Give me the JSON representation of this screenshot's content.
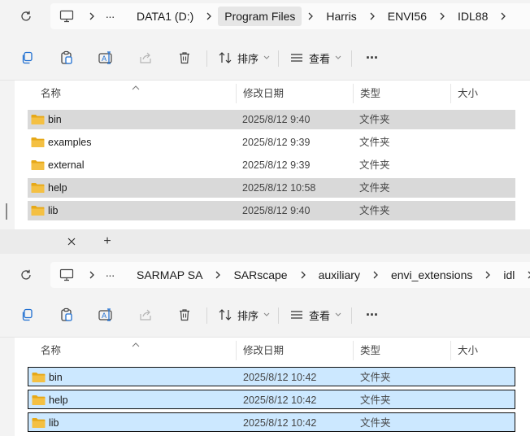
{
  "window1": {
    "breadcrumbs": [
      "DATA1 (D:)",
      "Program Files",
      "Harris",
      "ENVI56",
      "IDL88"
    ],
    "active_crumb_index": 1,
    "toolbar": {
      "sort_label": "排序",
      "view_label": "查看",
      "more_label": "···"
    },
    "columns": {
      "name": "名称",
      "date": "修改日期",
      "type": "类型",
      "size": "大小"
    },
    "rows": [
      {
        "name": "bin",
        "date": "2025/8/12 9:40",
        "type": "文件夹",
        "state": "selected-gray"
      },
      {
        "name": "examples",
        "date": "2025/8/12 9:39",
        "type": "文件夹",
        "state": "normal"
      },
      {
        "name": "external",
        "date": "2025/8/12 9:39",
        "type": "文件夹",
        "state": "normal"
      },
      {
        "name": "help",
        "date": "2025/8/12 10:58",
        "type": "文件夹",
        "state": "selected-gray"
      },
      {
        "name": "lib",
        "date": "2025/8/12 9:40",
        "type": "文件夹",
        "state": "selected-gray"
      }
    ]
  },
  "window2": {
    "tab_add_label": "+",
    "breadcrumbs": [
      "SARMAP SA",
      "SARscape",
      "auxiliary",
      "envi_extensions",
      "idl"
    ],
    "toolbar": {
      "sort_label": "排序",
      "view_label": "查看",
      "more_label": "···"
    },
    "columns": {
      "name": "名称",
      "date": "修改日期",
      "type": "类型",
      "size": "大小"
    },
    "rows": [
      {
        "name": "bin",
        "date": "2025/8/12 10:42",
        "type": "文件夹",
        "state": "selected-blue"
      },
      {
        "name": "help",
        "date": "2025/8/12 10:42",
        "type": "文件夹",
        "state": "selected-blue"
      },
      {
        "name": "lib",
        "date": "2025/8/12 10:42",
        "type": "文件夹",
        "state": "selected-blue"
      }
    ]
  },
  "colors": {
    "folder": "#f4c043",
    "folder_dark": "#e6a817",
    "select_gray": "#d9d9d9",
    "select_blue": "#cce8ff",
    "chrome": "#f3f3f3"
  }
}
